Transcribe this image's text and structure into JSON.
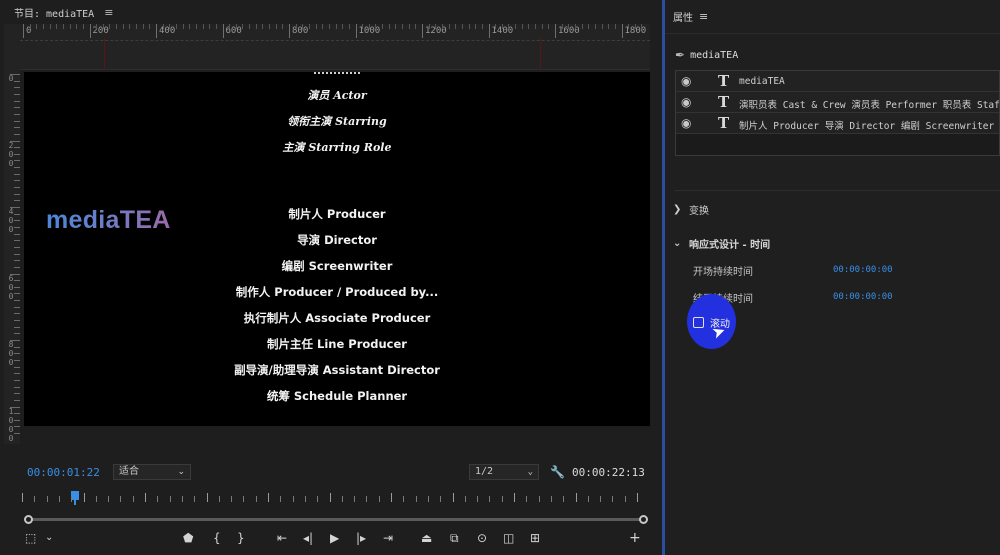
{
  "program": {
    "title": "节目: mediaTEA",
    "menu_glyph": "≡",
    "ruler_labels": [
      "0",
      "200",
      "400",
      "600",
      "800",
      "1000",
      "1200",
      "1400",
      "1600",
      "1800"
    ],
    "left_ruler_labels": [
      "0",
      "200",
      "400",
      "600",
      "800",
      "1000"
    ],
    "logo": "mediaTEA",
    "credits": [
      "演员 Actor",
      "领衔主演 Starring",
      "主演 Starring Role",
      "制片人 Producer",
      "导演 Director",
      "编剧 Screenwriter",
      "制作人 Producer / Produced by...",
      "执行制片人 Associate Producer",
      "制片主任 Line Producer",
      "副导演/助理导演 Assistant Director",
      "统筹 Schedule Planner"
    ],
    "timecode_current": "00:00:01:22",
    "fit_dropdown": "适合",
    "resolution_dropdown": "1/2",
    "timecode_duration": "00:00:22:13",
    "playhead_fraction": 0.085,
    "transport_icons": [
      "marker-icon",
      "in-point-icon",
      "out-point-icon",
      "go-to-in-icon",
      "step-back-icon",
      "play-icon",
      "step-forward-icon",
      "go-to-out-icon",
      "lift-icon",
      "extract-icon",
      "export-frame-icon",
      "comparison-view-icon",
      "multi-camera-icon",
      "add-icon"
    ]
  },
  "properties": {
    "title": "属性",
    "menu_glyph": "≡",
    "clip_name": "mediaTEA",
    "layers": [
      {
        "text": "mediaTEA"
      },
      {
        "text": "演职员表 Cast & Crew 演员表 Performer 职员表 Staff 演员"
      },
      {
        "text": "制片人 Producer 导演 Director 编剧 Screenwriter 制作人 P"
      }
    ],
    "transform_label": "变换",
    "responsive_label": "响应式设计 - 时间",
    "intro_label": "开场持续时间",
    "intro_value": "00:00:00:00",
    "outro_label": "结尾持续时间",
    "outro_value": "00:00:00:00",
    "roll_label": "滚动",
    "roll_checked": false
  },
  "colors": {
    "accent_blue": "#3a8ee6",
    "panel_focus": "#2b4fa0",
    "cursor_highlight": "#2330e0"
  }
}
